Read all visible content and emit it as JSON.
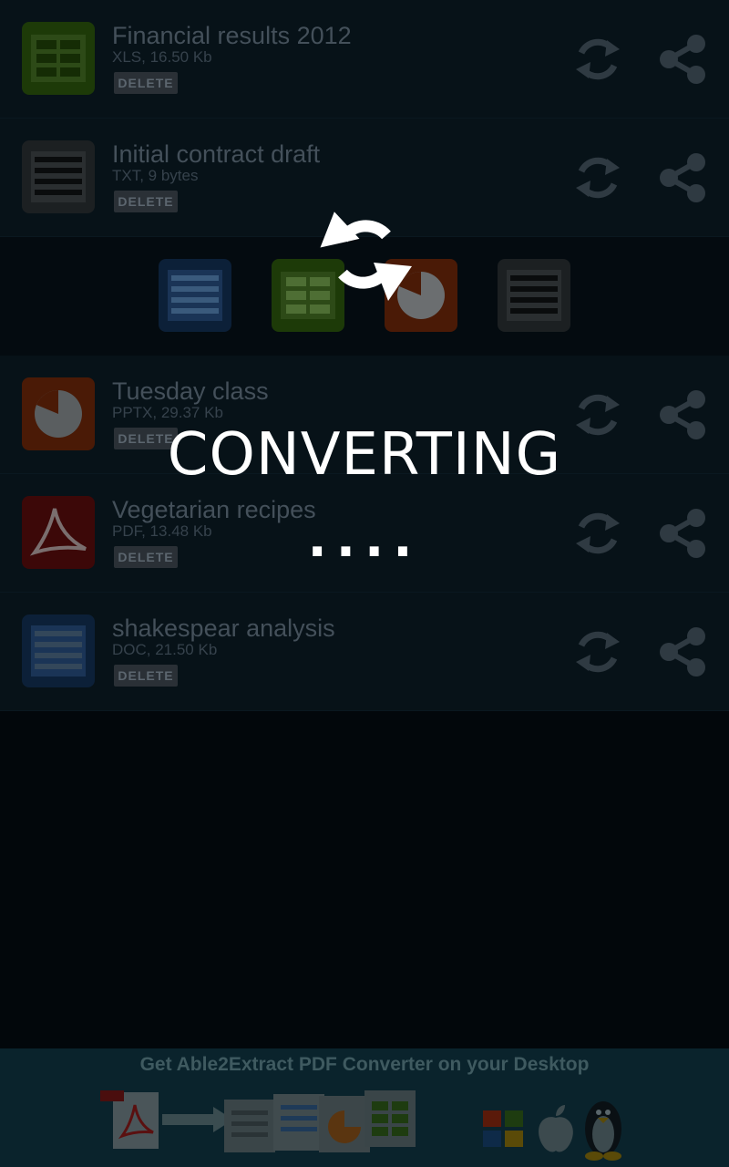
{
  "files": [
    {
      "name": "Financial results 2012",
      "meta": "XLS, 16.50 Kb",
      "type": "xls",
      "icon": "spreadsheet-icon",
      "delete_label": "DELETE"
    },
    {
      "name": "Initial contract draft",
      "meta": "TXT, 9 bytes",
      "type": "txt",
      "icon": "text-document-icon",
      "delete_label": "DELETE"
    },
    {
      "name": "Tuesday class",
      "meta": "PPTX, 29.37 Kb",
      "type": "pptx",
      "icon": "presentation-icon",
      "delete_label": "DELETE"
    },
    {
      "name": "Vegetarian recipes",
      "meta": "PDF, 13.48 Kb",
      "type": "pdf",
      "icon": "pdf-icon",
      "delete_label": "DELETE"
    },
    {
      "name": "shakespear analysis",
      "meta": "DOC, 21.50 Kb",
      "type": "doc",
      "icon": "word-document-icon",
      "delete_label": "DELETE"
    }
  ],
  "format_options": [
    {
      "type": "doc",
      "icon": "word-document-icon"
    },
    {
      "type": "xls",
      "icon": "spreadsheet-icon"
    },
    {
      "type": "pptx",
      "icon": "presentation-icon"
    },
    {
      "type": "txt",
      "icon": "text-document-icon"
    }
  ],
  "overlay": {
    "icon": "refresh-icon",
    "label": "CONVERTING",
    "dots": "...."
  },
  "ad": {
    "text": "Get Able2Extract PDF Converter on your Desktop"
  },
  "colors": {
    "background": "#02070b",
    "xls": "#1d3a08",
    "txt": "#1c2022",
    "pptx": "#4a1a06",
    "pdf": "#3c0808",
    "doc": "#0c2038"
  }
}
